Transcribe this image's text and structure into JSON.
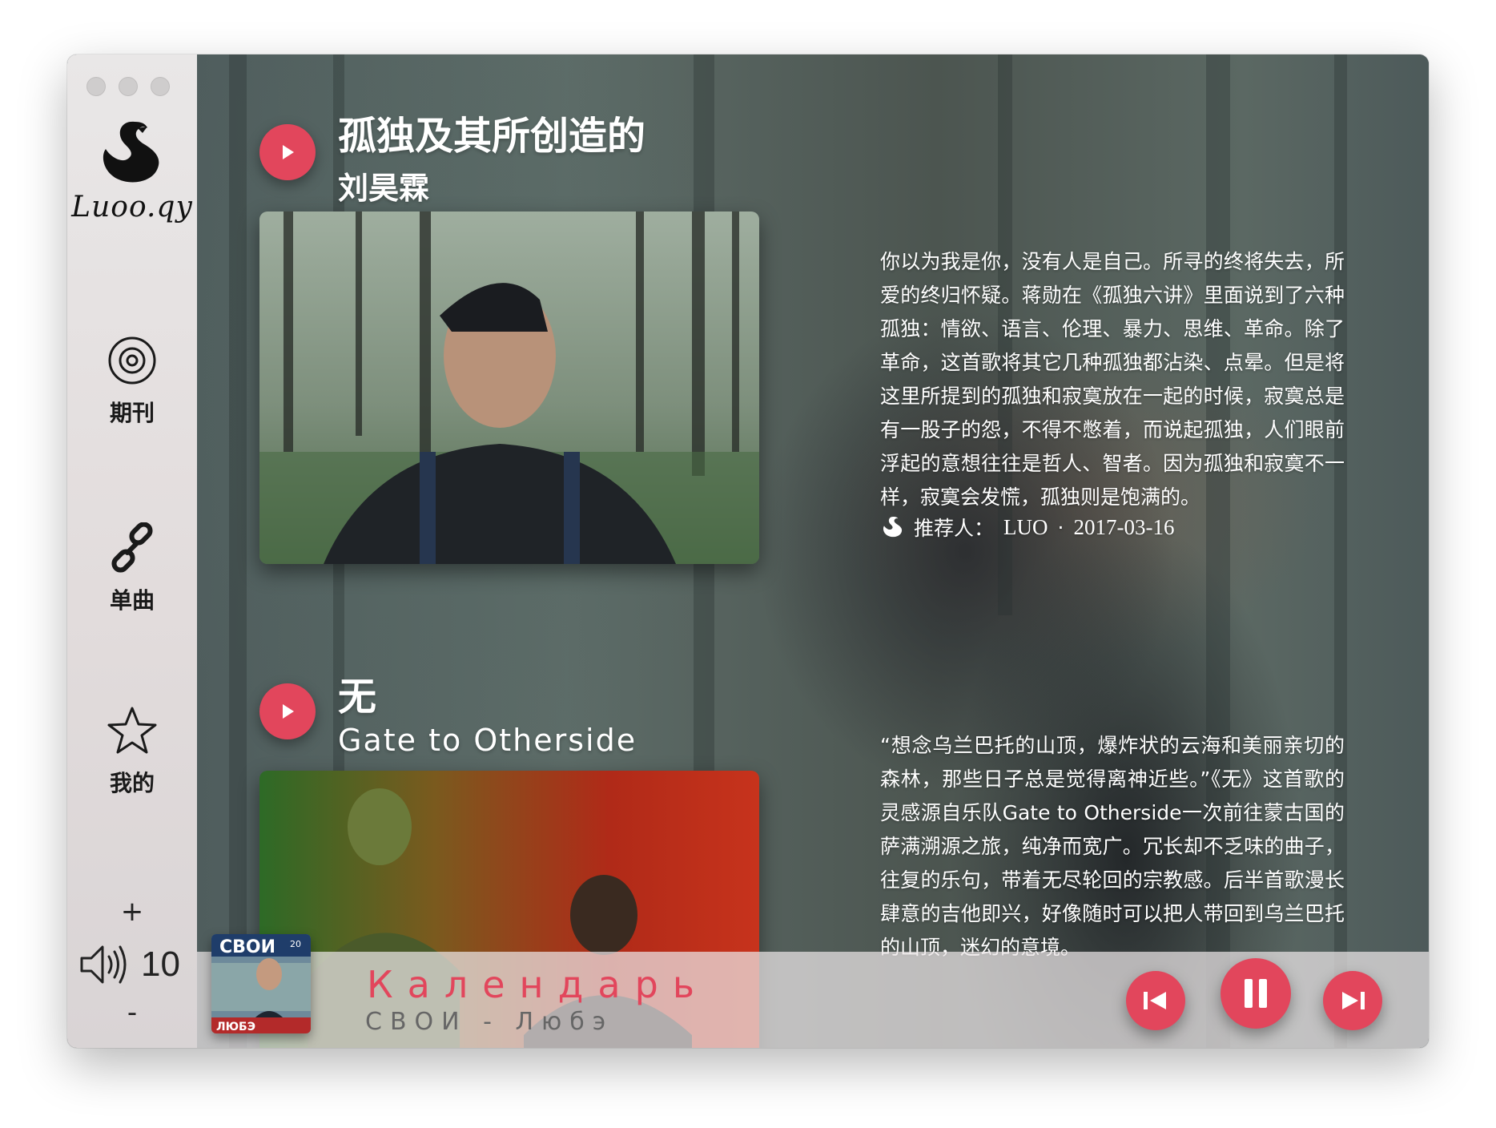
{
  "app": {
    "logo_text": "Luoo.qy"
  },
  "sidebar": {
    "items": [
      {
        "label": "期刊",
        "icon": "vinyl-icon"
      },
      {
        "label": "单曲",
        "icon": "link-icon"
      },
      {
        "label": "我的",
        "icon": "star-icon"
      }
    ],
    "volume": {
      "plus": "+",
      "minus": "-",
      "value": "10",
      "icon": "speaker-icon"
    }
  },
  "songs": [
    {
      "title": "孤独及其所创造的",
      "artist": "刘昊霖",
      "description": "你以为我是你，没有人是自己。所寻的终将失去，所爱的终归怀疑。蒋勋在《孤独六讲》里面说到了六种孤独：情欲、语言、伦理、暴力、思维、革命。除了革命，这首歌将其它几种孤独都沾染、点晕。但是将这里所提到的孤独和寂寞放在一起的时候，寂寞总是有一股子的怨，不得不憋着，而说起孤独，人们眼前浮起的意想往往是哲人、智者。因为孤独和寂寞不一样，寂寞会发慌，孤独则是饱满的。",
      "recommend_label": "推荐人：",
      "recommender": "LUO",
      "separator": "·",
      "date": "2017-03-16"
    },
    {
      "title": "无",
      "artist": "Gate to Otherside",
      "description": "“想念乌兰巴托的山顶，爆炸状的云海和美丽亲切的森林，那些日子总是觉得离神近些。”《无》这首歌的灵感源自乐队Gate to Otherside一次前往蒙古国的萨满溯源之旅，纯净而宽广。冗长却不乏味的曲子，往复的乐句，带着无尽轮回的宗教感。后半首歌漫长肆意的吉他即兴，好像随时可以把人带回到乌兰巴托的山顶，迷幻的意境。"
    }
  ],
  "player": {
    "title": "Календарь",
    "artist": "СВОИ - Любэ",
    "cover_text": "СВОИ",
    "cover_badge": "20",
    "cover_bottom": "ЛЮБЭ"
  },
  "colors": {
    "accent": "#e2465c",
    "sidebar_bg": "#e6e3e3"
  }
}
